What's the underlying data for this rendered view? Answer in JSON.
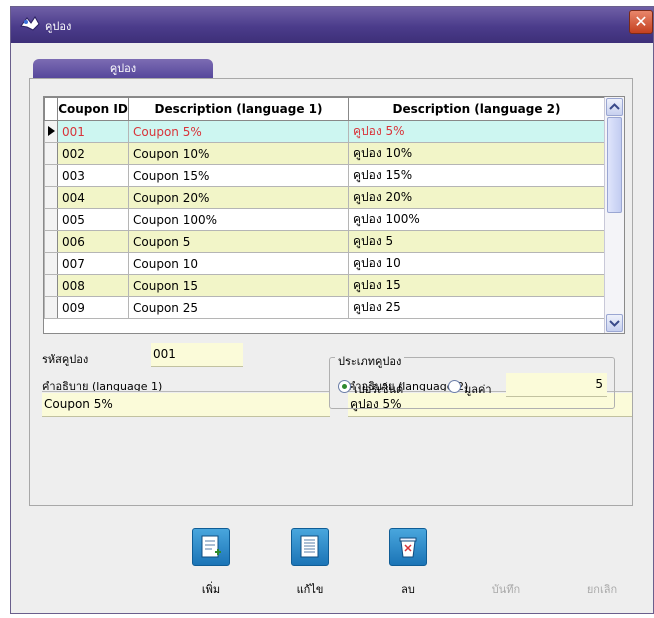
{
  "window": {
    "title": "คูปอง",
    "close_glyph": "✕"
  },
  "tab": {
    "label": "คูปอง"
  },
  "grid": {
    "columns": [
      "Coupon ID",
      "Description (language 1)",
      "Description (language 2)"
    ],
    "rows": [
      {
        "id": "001",
        "desc1": "Coupon 5%",
        "desc2": "คูปอง 5%"
      },
      {
        "id": "002",
        "desc1": "Coupon 10%",
        "desc2": "คูปอง 10%"
      },
      {
        "id": "003",
        "desc1": "Coupon 15%",
        "desc2": "คูปอง 15%"
      },
      {
        "id": "004",
        "desc1": "Coupon 20%",
        "desc2": "คูปอง 20%"
      },
      {
        "id": "005",
        "desc1": "Coupon 100%",
        "desc2": "คูปอง 100%"
      },
      {
        "id": "006",
        "desc1": "Coupon 5",
        "desc2": "คูปอง 5"
      },
      {
        "id": "007",
        "desc1": "Coupon 10",
        "desc2": "คูปอง 10"
      },
      {
        "id": "008",
        "desc1": "Coupon 15",
        "desc2": "คูปอง 15"
      },
      {
        "id": "009",
        "desc1": "Coupon 25",
        "desc2": "คูปอง 25"
      }
    ]
  },
  "form": {
    "code_label": "รหัสคูปอง",
    "code_value": "001",
    "desc1_label": "คำอธิบาย (language 1)",
    "desc1_value": "Coupon 5%",
    "desc2_label": "คำอธิบาย (language 2)",
    "desc2_value": "คูปอง 5%",
    "type_group_label": "ประเภทคูปอง",
    "type_percent_label": "เปอร์เซ็นต์",
    "type_value_label": "มูลค่า",
    "type_selected": "percent",
    "amount_value": "5"
  },
  "toolbar": {
    "add_label": "เพิ่ม",
    "edit_label": "แก้ไข",
    "delete_label": "ลบ",
    "save_label": "บันทึก",
    "cancel_label": "ยกเลิก"
  },
  "colors": {
    "accent": "#54459a",
    "row_highlight": "#f2f5c8",
    "selected_row": "#cdf6f1",
    "selected_text": "#d8343a"
  }
}
